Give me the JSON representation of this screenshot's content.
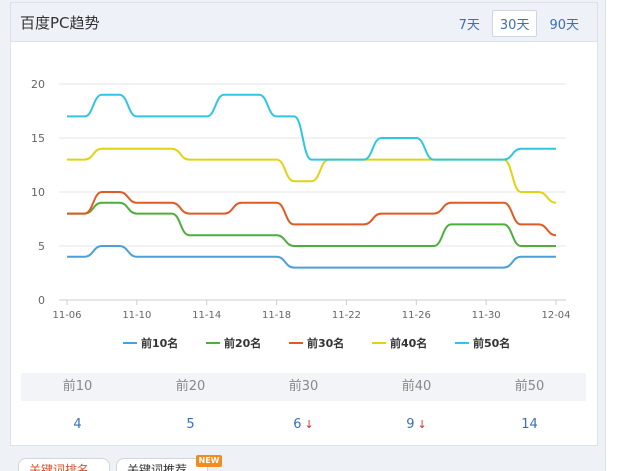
{
  "panel": {
    "title": "百度PC趋势",
    "range_tabs": [
      {
        "label": "7天",
        "active": false
      },
      {
        "label": "30天",
        "active": true
      },
      {
        "label": "90天",
        "active": false
      }
    ]
  },
  "chart_data": {
    "type": "line",
    "x": [
      "11-06",
      "11-07",
      "11-08",
      "11-09",
      "11-10",
      "11-11",
      "11-12",
      "11-13",
      "11-14",
      "11-15",
      "11-16",
      "11-17",
      "11-18",
      "11-19",
      "11-20",
      "11-21",
      "11-22",
      "11-23",
      "11-24",
      "11-25",
      "11-26",
      "11-27",
      "11-28",
      "11-29",
      "11-30",
      "12-01",
      "12-02",
      "12-03",
      "12-04"
    ],
    "xticks": [
      "11-06",
      "11-10",
      "11-14",
      "11-18",
      "11-22",
      "11-26",
      "11-30",
      "12-04"
    ],
    "ylim": [
      0,
      20
    ],
    "yticks": [
      0,
      5,
      10,
      15,
      20
    ],
    "grid": "horizontal",
    "legend_position": "bottom",
    "series": [
      {
        "name": "前10名",
        "color": "#4aa0d9",
        "values": [
          4,
          4,
          5,
          5,
          4,
          4,
          4,
          4,
          4,
          4,
          4,
          4,
          4,
          3,
          3,
          3,
          3,
          3,
          3,
          3,
          3,
          3,
          3,
          3,
          3,
          3,
          4,
          4,
          4
        ]
      },
      {
        "name": "前20名",
        "color": "#4caf3a",
        "values": [
          8,
          8,
          9,
          9,
          8,
          8,
          8,
          6,
          6,
          6,
          6,
          6,
          6,
          5,
          5,
          5,
          5,
          5,
          5,
          5,
          5,
          5,
          7,
          7,
          7,
          7,
          5,
          5,
          5
        ]
      },
      {
        "name": "前30名",
        "color": "#e05a22",
        "values": [
          8,
          8,
          10,
          10,
          9,
          9,
          9,
          8,
          8,
          8,
          9,
          9,
          9,
          7,
          7,
          7,
          7,
          7,
          8,
          8,
          8,
          8,
          9,
          9,
          9,
          9,
          7,
          7,
          6
        ]
      },
      {
        "name": "前40名",
        "color": "#e0d313",
        "values": [
          13,
          13,
          14,
          14,
          14,
          14,
          14,
          13,
          13,
          13,
          13,
          13,
          13,
          11,
          11,
          13,
          13,
          13,
          13,
          13,
          13,
          13,
          13,
          13,
          13,
          13,
          10,
          10,
          9
        ]
      },
      {
        "name": "前50名",
        "color": "#30c6e3",
        "values": [
          17,
          17,
          19,
          19,
          17,
          17,
          17,
          17,
          17,
          19,
          19,
          19,
          17,
          17,
          13,
          13,
          13,
          13,
          15,
          15,
          15,
          13,
          13,
          13,
          13,
          13,
          14,
          14,
          14
        ]
      }
    ]
  },
  "stats": {
    "headers": [
      "前10",
      "前20",
      "前30",
      "前40",
      "前50"
    ],
    "values": [
      {
        "value": "4",
        "arrow": ""
      },
      {
        "value": "5",
        "arrow": ""
      },
      {
        "value": "6",
        "arrow": "down"
      },
      {
        "value": "9",
        "arrow": "down"
      },
      {
        "value": "14",
        "arrow": ""
      }
    ],
    "arrow_color": "#d42e2e"
  },
  "bottom_tabs": [
    {
      "label": "关键词排名"
    },
    {
      "label": "关键词推荐"
    }
  ],
  "badge_new": "NEW"
}
